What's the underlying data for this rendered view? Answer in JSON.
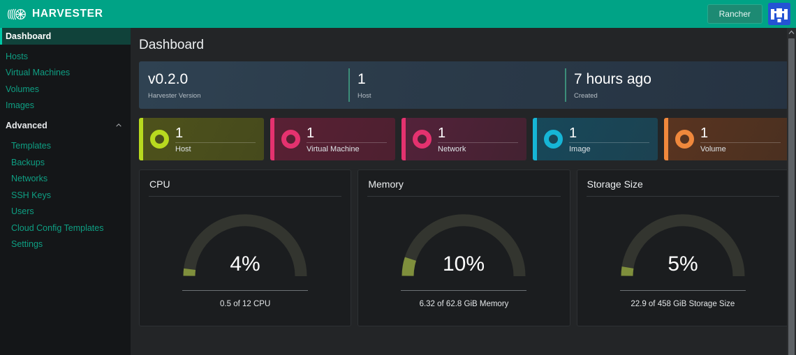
{
  "brand": {
    "name": "HARVESTER",
    "logo_icon": "harvester-logo-icon"
  },
  "topbar": {
    "rancher_label": "Rancher",
    "rancher_logo_icon": "rancher-logo-icon"
  },
  "sidebar": {
    "items": [
      {
        "label": "Dashboard",
        "active": true
      },
      {
        "label": "Hosts",
        "active": false
      },
      {
        "label": "Virtual Machines",
        "active": false
      },
      {
        "label": "Volumes",
        "active": false
      },
      {
        "label": "Images",
        "active": false
      }
    ],
    "group": {
      "label": "Advanced",
      "chevron_icon": "chevron-up-icon",
      "expanded": true,
      "items": [
        {
          "label": "Templates"
        },
        {
          "label": "Backups"
        },
        {
          "label": "Networks"
        },
        {
          "label": "SSH Keys"
        },
        {
          "label": "Users"
        },
        {
          "label": "Cloud Config Templates"
        },
        {
          "label": "Settings"
        }
      ]
    }
  },
  "page": {
    "title": "Dashboard"
  },
  "banner": {
    "cells": [
      {
        "value": "v0.2.0",
        "label": "Harvester Version"
      },
      {
        "value": "1",
        "label": "Host"
      },
      {
        "value": "7 hours ago",
        "label": "Created"
      }
    ]
  },
  "resource_cards": [
    {
      "count": "1",
      "label": "Host",
      "color": "#b8d91f",
      "bg_from": "#4e521b",
      "bg_to": "#464a1c",
      "ring_icon": "ring-icon"
    },
    {
      "count": "1",
      "label": "Virtual Machine",
      "color": "#e4326f",
      "bg_from": "#5a2034",
      "bg_to": "#4d2030",
      "ring_icon": "ring-icon"
    },
    {
      "count": "1",
      "label": "Network",
      "color": "#e4326f",
      "bg_from": "#54223a",
      "bg_to": "#432231",
      "ring_icon": "ring-icon"
    },
    {
      "count": "1",
      "label": "Image",
      "color": "#16b5d6",
      "bg_from": "#17485a",
      "bg_to": "#1c4251",
      "ring_icon": "ring-icon"
    },
    {
      "count": "1",
      "label": "Volume",
      "color": "#f0883c",
      "bg_from": "#5a3420",
      "bg_to": "#4a3020",
      "ring_icon": "ring-icon"
    }
  ],
  "chart_data": [
    {
      "type": "gauge",
      "title": "CPU",
      "percent": 4,
      "display": "4%",
      "footer": "0.5 of 12 CPU",
      "used": 0.5,
      "total": 12,
      "unit": "CPU",
      "track_color": "#33352f",
      "value_color": "#7f8f3c",
      "range": [
        0,
        100
      ]
    },
    {
      "type": "gauge",
      "title": "Memory",
      "percent": 10,
      "display": "10%",
      "footer": "6.32 of 62.8 GiB Memory",
      "used": 6.32,
      "total": 62.8,
      "unit": "GiB Memory",
      "track_color": "#33352f",
      "value_color": "#7f8f3c",
      "range": [
        0,
        100
      ]
    },
    {
      "type": "gauge",
      "title": "Storage Size",
      "percent": 5,
      "display": "5%",
      "footer": "22.9 of 458 GiB Storage Size",
      "used": 22.9,
      "total": 458,
      "unit": "GiB Storage Size",
      "track_color": "#33352f",
      "value_color": "#7f8f3c",
      "range": [
        0,
        100
      ]
    }
  ],
  "scrollbar": {
    "up_arrow_icon": "chevron-up-icon"
  }
}
